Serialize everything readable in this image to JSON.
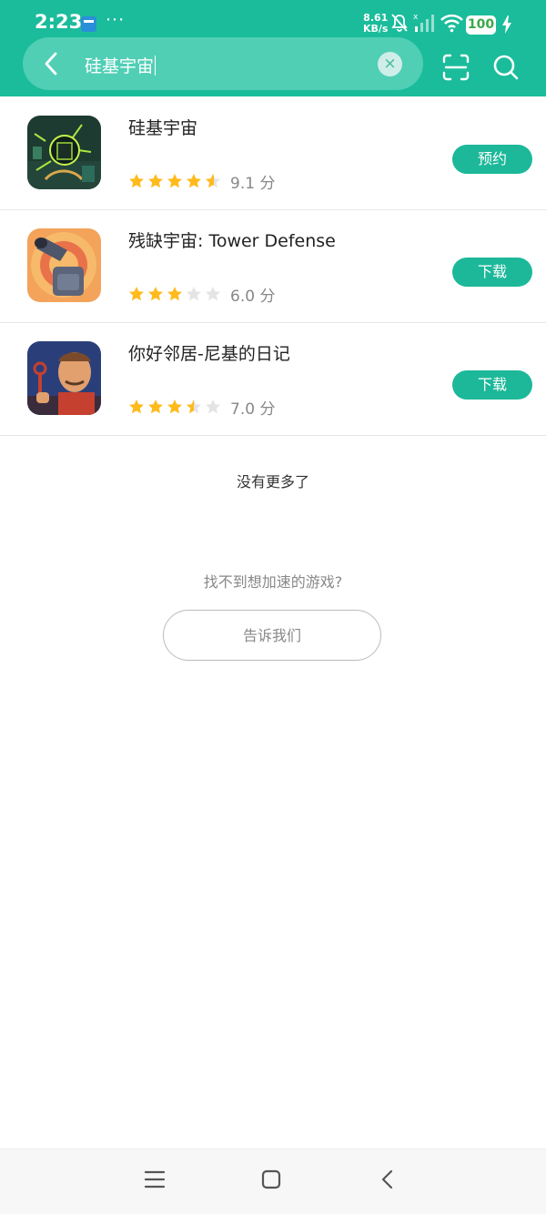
{
  "status_bar": {
    "time": "2:23",
    "dots": "···",
    "speed_value": "8.61",
    "speed_unit": "KB/s",
    "battery": "100"
  },
  "search": {
    "query": "硅基宇宙",
    "clear_glyph": "×"
  },
  "results": [
    {
      "name": "硅基宇宙",
      "rating": 9.1,
      "score_text": "9.1 分",
      "button": "预约",
      "icon": "silicon-universe-game-icon"
    },
    {
      "name": "残缺宇宙: Tower Defense",
      "rating": 6.0,
      "score_text": "6.0 分",
      "button": "下载",
      "icon": "tower-defense-cannon-icon"
    },
    {
      "name": "你好邻居-尼基的日记",
      "rating": 7.0,
      "score_text": "7.0 分",
      "button": "下载",
      "icon": "hello-neighbor-icon"
    }
  ],
  "footer": {
    "no_more": "没有更多了",
    "cant_find": "找不到想加速的游戏?",
    "tell_us": "告诉我们"
  },
  "colors": {
    "accent": "#1bbc9b",
    "star_filled": "#ffba1c",
    "star_empty": "#e4e4e4"
  }
}
